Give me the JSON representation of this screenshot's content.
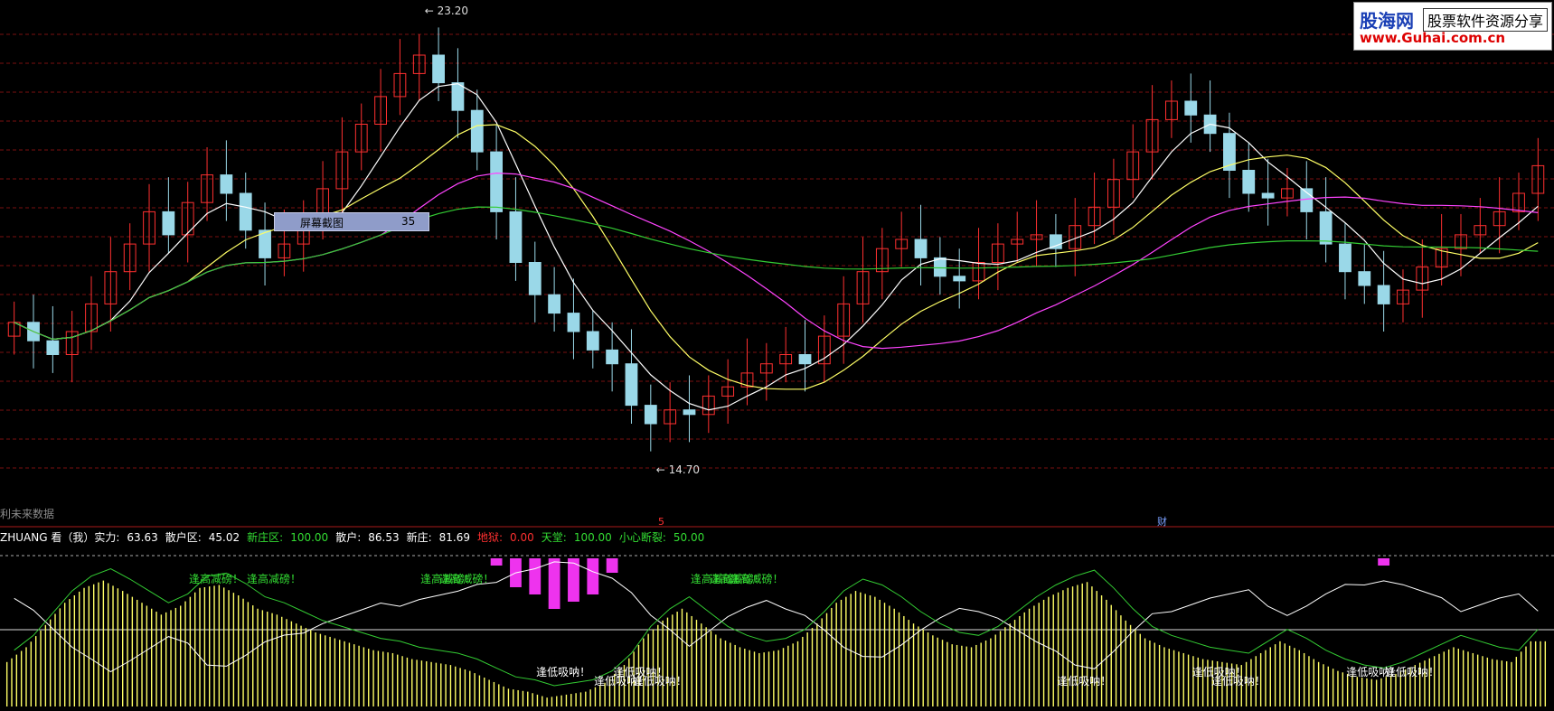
{
  "branding": {
    "name": "股海网",
    "tagline": "股票软件资源分享",
    "url": "www.Guhai.com.cn"
  },
  "screenshot_box": {
    "label": "屏幕截图",
    "value": "35"
  },
  "future_data_hint": "利未来数据",
  "infobar": [
    {
      "label": "ZHUANG 看（我）实力:",
      "value": "63.63",
      "color": "#ffffff"
    },
    {
      "label": "散户区:",
      "value": "45.02",
      "color": "#ffffff"
    },
    {
      "label": "新庄区:",
      "value": "100.00",
      "color": "#33dd33"
    },
    {
      "label": "散户:",
      "value": "86.53",
      "color": "#ffffff"
    },
    {
      "label": "新庄:",
      "value": "81.69",
      "color": "#ffffff"
    },
    {
      "label": "地狱:",
      "value": "0.00",
      "color": "#ff3030"
    },
    {
      "label": "天堂:",
      "value": "100.00",
      "color": "#33dd33"
    },
    {
      "label": "小心断裂:",
      "value": "50.00",
      "color": "#33dd33"
    }
  ],
  "date_markers": [
    {
      "text": "5",
      "color": "#ff3030"
    },
    {
      "text": "财",
      "color": "#7aa0ff"
    }
  ],
  "colors": {
    "background": "#000000",
    "grid": "#7a1010",
    "candle_up": "#ff3030",
    "candle_down": "#9ad8e8",
    "ma5": "#ffffff",
    "ma10": "#ffff66",
    "ma20": "#ff44ff",
    "ma60": "#33cc33",
    "volume_bar": "#ffff66",
    "negative_bar": "#ee33ee",
    "buy_text": "#ffffff",
    "sell_text": "#33dd33"
  },
  "chart_data": [
    {
      "type": "candlestick",
      "title": "",
      "price_high_label": "23.20",
      "price_low_label": "14.70",
      "ylim": [
        14.0,
        24.0
      ],
      "close": [
        17.2,
        16.8,
        16.5,
        17.0,
        17.6,
        18.3,
        18.9,
        19.6,
        19.1,
        19.8,
        20.4,
        20.0,
        19.2,
        18.6,
        18.9,
        19.4,
        20.1,
        20.9,
        21.5,
        22.1,
        22.6,
        23.0,
        22.4,
        21.8,
        20.9,
        19.6,
        18.5,
        17.8,
        17.4,
        17.0,
        16.6,
        16.3,
        15.4,
        15.0,
        15.3,
        15.2,
        15.6,
        15.8,
        16.1,
        16.3,
        16.5,
        16.3,
        16.9,
        17.6,
        18.3,
        18.8,
        19.0,
        18.6,
        18.2,
        18.1,
        18.5,
        18.9,
        19.0,
        19.1,
        18.8,
        19.3,
        19.7,
        20.3,
        20.9,
        21.6,
        22.0,
        21.7,
        21.3,
        20.5,
        20.0,
        19.9,
        20.1,
        19.6,
        18.9,
        18.3,
        18.0,
        17.6,
        17.9,
        18.4,
        18.8,
        19.1,
        19.3,
        19.6,
        20.0,
        20.6
      ],
      "volume_ind": [
        30,
        40,
        55,
        70,
        80,
        85,
        78,
        70,
        62,
        68,
        80,
        82,
        75,
        66,
        62,
        56,
        50,
        46,
        42,
        38,
        36,
        32,
        30,
        28,
        24,
        18,
        12,
        10,
        6,
        8,
        10,
        16,
        28,
        46,
        58,
        66,
        56,
        46,
        40,
        36,
        38,
        44,
        56,
        70,
        78,
        74,
        66,
        56,
        48,
        42,
        40,
        46,
        56,
        66,
        74,
        80,
        84,
        72,
        58,
        46,
        40,
        36,
        32,
        30,
        28,
        36,
        44,
        38,
        30,
        24,
        20,
        18,
        22,
        28,
        34,
        40,
        36,
        32,
        30,
        44
      ],
      "series": [
        {
          "name": "MA5",
          "period": 5
        },
        {
          "name": "MA10",
          "period": 10
        },
        {
          "name": "MA20",
          "period": 20
        },
        {
          "name": "MA60",
          "period": 60
        }
      ]
    }
  ],
  "signals": {
    "sell_text": "逢高减磅！",
    "buy_text": "逢低吸呐！",
    "sell_positions": [
      10,
      13,
      22,
      23,
      36,
      37,
      38
    ],
    "buy_positions": [
      28,
      31,
      32,
      33,
      55,
      62,
      63,
      70,
      72
    ]
  }
}
